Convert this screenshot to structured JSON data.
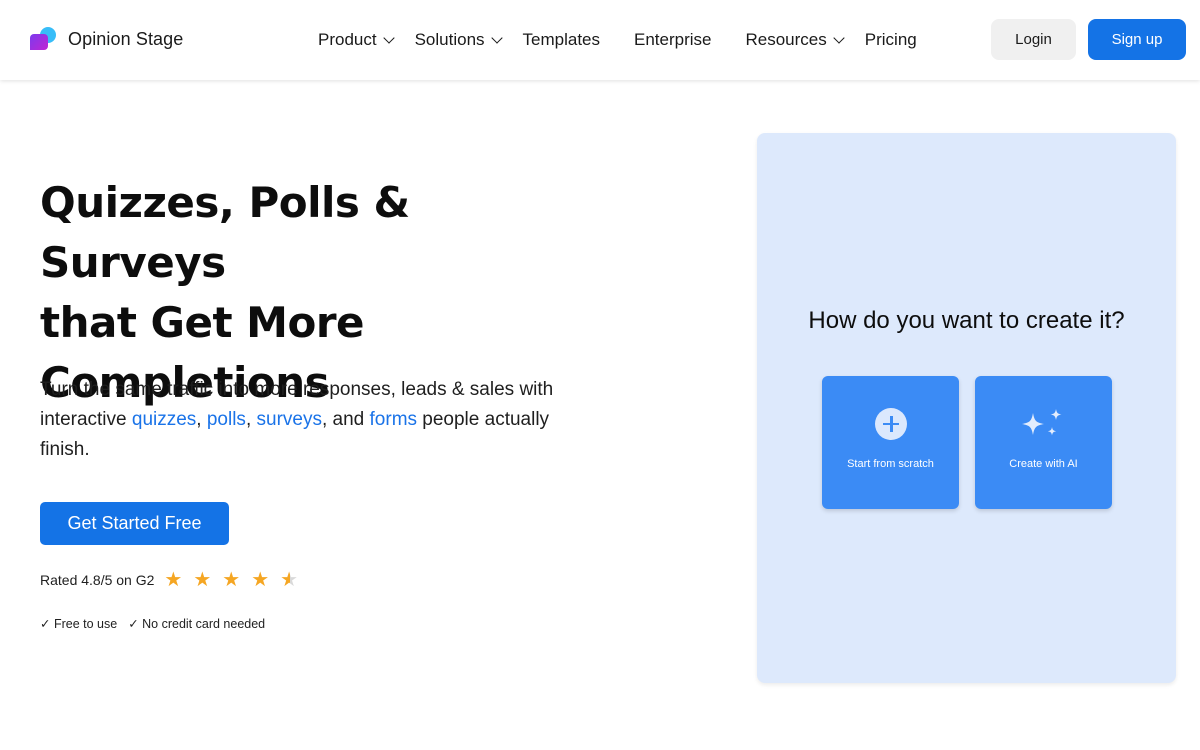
{
  "brand": {
    "name": "Opinion Stage"
  },
  "nav": {
    "product": "Product",
    "solutions": "Solutions",
    "templates": "Templates",
    "enterprise": "Enterprise",
    "resources": "Resources",
    "pricing": "Pricing"
  },
  "header": {
    "login": "Login",
    "signup": "Sign up"
  },
  "hero": {
    "title_line1": "Quizzes, Polls & Surveys",
    "title_line2": "that Get More",
    "title_line3": "Completions",
    "sub_part1": "Turn the same traffic into more responses, leads & sales with interactive ",
    "link_quizzes": "quizzes",
    "sep1": ", ",
    "link_polls": "polls",
    "sep2": ", ",
    "link_surveys": "surveys",
    "sep3": ", and ",
    "link_forms": "forms",
    "sub_part2": " people actually finish.",
    "cta": "Get Started Free",
    "rating_text": "Rated 4.8/5 on G2",
    "rating_value": 4.8,
    "rating_max": 5,
    "check1": "✓ Free to use",
    "check2": "✓ No credit card needed"
  },
  "panel": {
    "title": "How do you want to create it?",
    "option1": "Start from scratch",
    "option2": "Create with AI"
  },
  "colors": {
    "primary": "#1473e6",
    "link": "#1a73e8",
    "star": "#f5a623",
    "panel_bg": "#dde9fc",
    "card": "#3b8bf5"
  },
  "icons": [
    "plus-circle-icon",
    "sparkle-icon",
    "chevron-down-icon",
    "star-icon"
  ]
}
